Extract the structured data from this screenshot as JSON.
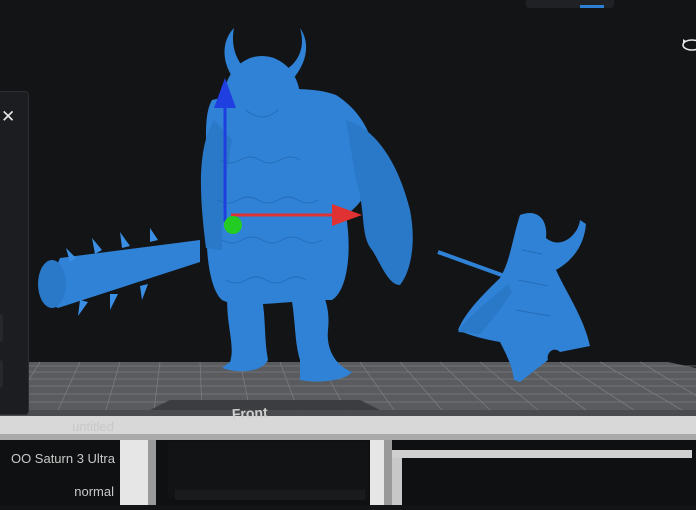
{
  "window": {
    "top_tab_accent": "#2d7fd3"
  },
  "scene": {
    "plate_label": "Front",
    "models": [
      {
        "name": "horned-yeti-monster",
        "color": "#2f82d6"
      },
      {
        "name": "sword-wielding-warrior",
        "color": "#2f82d6"
      }
    ],
    "gizmo": {
      "x_color": "#e03232",
      "y_color": "#1f3fe0",
      "origin_color": "#22cc22"
    }
  },
  "left_panel": {
    "close_icon": "close-icon"
  },
  "project_info": {
    "file_name": "untitled",
    "printer": "OO Saturn 3 Ultra",
    "mode": "normal"
  }
}
